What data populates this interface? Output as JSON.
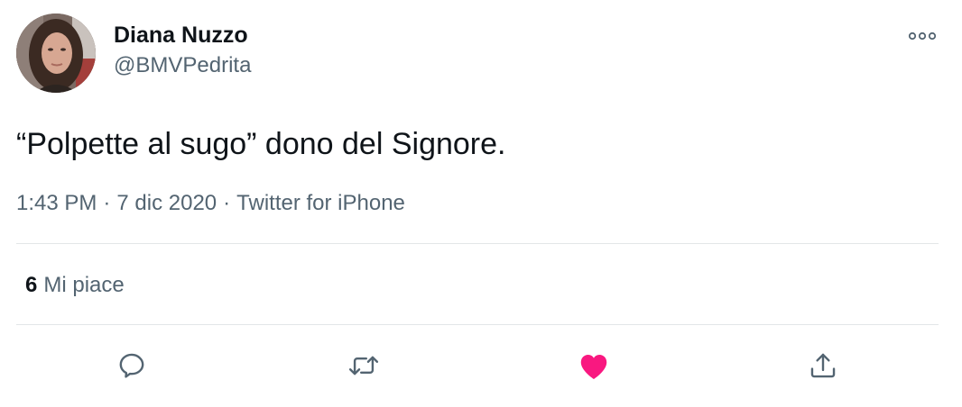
{
  "author": {
    "display_name": "Diana Nuzzo",
    "handle": "@BMVPedrita"
  },
  "tweet": {
    "text": "“Polpette al sugo” dono del Signore.",
    "time": "1:43 PM",
    "separator": "·",
    "date": "7 dic 2020",
    "source": "Twitter for iPhone"
  },
  "stats": {
    "likes_count": "6",
    "likes_label": "Mi piace"
  },
  "icons": {
    "more": "more-horizontal-icon",
    "reply": "reply-icon",
    "retweet": "retweet-icon",
    "like": "heart-icon",
    "share": "share-icon"
  },
  "colors": {
    "text_primary": "#0f1419",
    "text_secondary": "#536471",
    "divider": "#e3e6e8",
    "like_active": "#f91880",
    "icon_gray": "#536471"
  }
}
